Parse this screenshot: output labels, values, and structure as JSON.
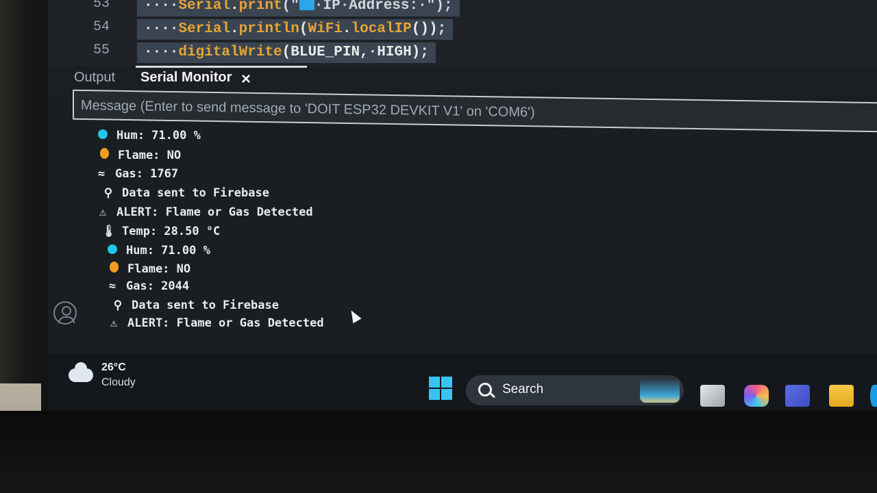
{
  "editor": {
    "lines": [
      {
        "num": "53",
        "pre": "····",
        "fn_obj": "Serial",
        "fn_name": "print",
        "args_a": "(\"",
        "args_b": "·IP·Address:·\");"
      },
      {
        "num": "54",
        "pre": "····",
        "fn_obj": "Serial",
        "fn_name": "println",
        "args_a": "(",
        "args_mid": "WiFi",
        "args_fn": "localIP",
        "args_b": "());"
      },
      {
        "num": "55",
        "pre": "····",
        "fn_name": "digitalWrite",
        "args_b": "(BLUE_PIN,·HIGH);"
      }
    ]
  },
  "panel": {
    "tab_output": "Output",
    "tab_serial": "Serial Monitor",
    "close_icon": "×",
    "message_placeholder": "Message (Enter to send message to 'DOIT ESP32 DEVKIT V1' on 'COM6')"
  },
  "serial_log": [
    {
      "icon": "drop-blue",
      "text": "Hum: 71.00 %"
    },
    {
      "icon": "drop-orange",
      "text": "Flame: NO"
    },
    {
      "icon": "fog",
      "text": "Gas: 1767"
    },
    {
      "icon": "satellite",
      "text": "Data sent to Firebase"
    },
    {
      "icon": "warning",
      "text": "ALERT: Flame or Gas Detected"
    },
    {
      "icon": "thermometer",
      "text": "Temp: 28.50 °C"
    },
    {
      "icon": "drop-blue",
      "text": "Hum: 71.00 %"
    },
    {
      "icon": "drop-orange",
      "text": "Flame: NO"
    },
    {
      "icon": "fog",
      "text": "Gas: 2044"
    },
    {
      "icon": "satellite",
      "text": "Data sent to Firebase"
    },
    {
      "icon": "warning",
      "text": "ALERT: Flame or Gas Detected"
    }
  ],
  "taskbar": {
    "weather_temp": "26°C",
    "weather_cond": "Cloudy",
    "search_label": "Search"
  },
  "colors": {
    "keyword": "#e6a532",
    "accent": "#38c3f5"
  }
}
